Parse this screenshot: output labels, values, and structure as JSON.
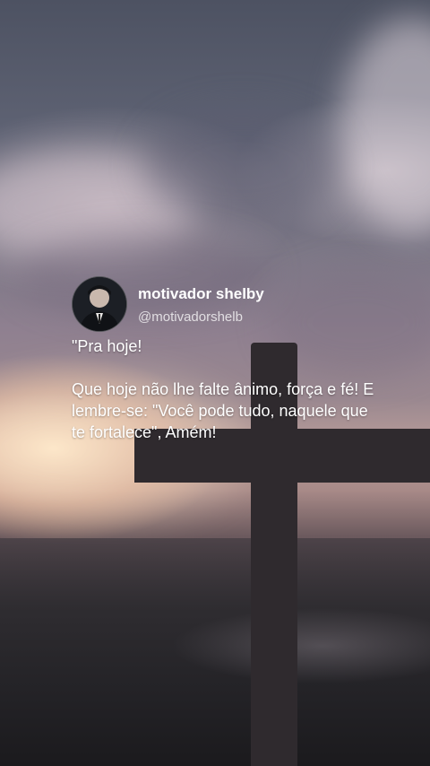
{
  "post": {
    "display_name": "motivador shelby",
    "handle": "@motivadorshelb",
    "text": "\"Pra hoje!\n\nQue hoje não lhe falte ânimo, força e fé! E lembre-se: \"Você pode tudo, naquele que te fortalece\", Amém!"
  },
  "colors": {
    "text": "#ffffff",
    "handle": "#d9d6dc",
    "cross": "#2f2a2e"
  }
}
